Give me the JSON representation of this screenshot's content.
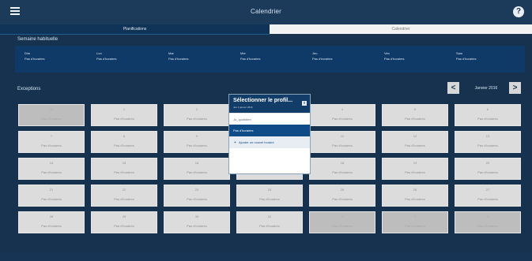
{
  "app": {
    "title": "Calendrier",
    "help_label": "?"
  },
  "tabs": {
    "active": "Planifications",
    "inactive": "Calendrier"
  },
  "weekly": {
    "label": "Semaine habituelle",
    "days": [
      {
        "day": "Dim",
        "status": "Pas d'horaires"
      },
      {
        "day": "Lun",
        "status": "Pas d'horaires"
      },
      {
        "day": "Mar",
        "status": "Pas d'horaires"
      },
      {
        "day": "Mer",
        "status": "Pas d'horaires"
      },
      {
        "day": "Jeu",
        "status": "Pas d'horaires"
      },
      {
        "day": "Ven",
        "status": "Pas d'horaires"
      },
      {
        "day": "Sam",
        "status": "Pas d'horaires"
      }
    ]
  },
  "exceptions": {
    "label": "Exceptions"
  },
  "date_nav": {
    "prev": "<",
    "next": ">",
    "month": "Janvier 2016"
  },
  "calendar": {
    "cells": [
      {
        "n": "31",
        "s": "Pas d'horaires",
        "dim": true
      },
      {
        "n": "1",
        "s": "Pas d'horaires",
        "dim": false
      },
      {
        "n": "2",
        "s": "Pas d'horaires",
        "dim": false
      },
      {
        "n": "3",
        "s": "Pas d'horaires",
        "dim": false
      },
      {
        "n": "4",
        "s": "Pas d'horaires",
        "dim": false
      },
      {
        "n": "5",
        "s": "Pas d'horaires",
        "dim": false
      },
      {
        "n": "6",
        "s": "Pas d'horaires",
        "dim": false
      },
      {
        "n": "7",
        "s": "Pas d'horaires",
        "dim": false
      },
      {
        "n": "8",
        "s": "Pas d'horaires",
        "dim": false
      },
      {
        "n": "9",
        "s": "Pas d'horaires",
        "dim": false
      },
      {
        "n": "10",
        "s": "Pas d'horaires",
        "dim": false
      },
      {
        "n": "11",
        "s": "Pas d'horaires",
        "dim": false
      },
      {
        "n": "12",
        "s": "Pas d'horaires",
        "dim": false
      },
      {
        "n": "13",
        "s": "Pas d'horaires",
        "dim": false
      },
      {
        "n": "14",
        "s": "Pas d'horaires",
        "dim": false
      },
      {
        "n": "15",
        "s": "Pas d'horaires",
        "dim": false
      },
      {
        "n": "16",
        "s": "Pas d'horaires",
        "dim": false
      },
      {
        "n": "17",
        "s": "Pas d'horaires",
        "dim": false
      },
      {
        "n": "18",
        "s": "Pas d'horaires",
        "dim": false
      },
      {
        "n": "19",
        "s": "Pas d'horaires",
        "dim": false
      },
      {
        "n": "20",
        "s": "Pas d'horaires",
        "dim": false
      },
      {
        "n": "21",
        "s": "Pas d'horaires",
        "dim": false
      },
      {
        "n": "22",
        "s": "Pas d'horaires",
        "dim": false
      },
      {
        "n": "23",
        "s": "Pas d'horaires",
        "dim": false
      },
      {
        "n": "24",
        "s": "Pas d'horaires",
        "dim": false
      },
      {
        "n": "25",
        "s": "Pas d'horaires",
        "dim": false
      },
      {
        "n": "26",
        "s": "Pas d'horaires",
        "dim": false
      },
      {
        "n": "27",
        "s": "Pas d'horaires",
        "dim": false
      },
      {
        "n": "28",
        "s": "Pas d'horaires",
        "dim": false
      },
      {
        "n": "29",
        "s": "Pas d'horaires",
        "dim": false
      },
      {
        "n": "30",
        "s": "Pas d'horaires",
        "dim": false
      },
      {
        "n": "31",
        "s": "Pas d'horaires",
        "dim": false
      },
      {
        "n": "1",
        "s": "Pas d'horaires",
        "dim": true
      },
      {
        "n": "2",
        "s": "Pas d'horaires",
        "dim": true
      },
      {
        "n": "3",
        "s": "Pas d'horaires",
        "dim": true
      }
    ]
  },
  "popup": {
    "title": "Sélectionner le profil...",
    "subtitle": "Jeu 1 janvier 2016",
    "close": "x",
    "options": [
      {
        "label": "Jo_quotidien",
        "kind": "plain"
      },
      {
        "label": "Pas d'horaires",
        "kind": "selected"
      },
      {
        "label": "Ajouter un nouvel horaire",
        "kind": "add"
      }
    ]
  }
}
